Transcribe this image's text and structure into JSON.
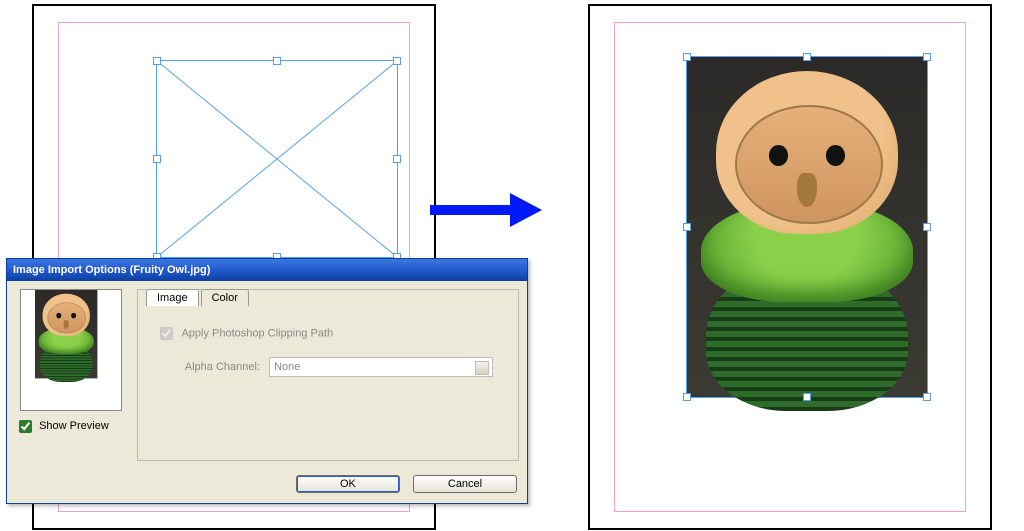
{
  "dialog": {
    "title": "Image Import Options (Fruity Owl.jpg)",
    "tabs": {
      "image": "Image",
      "color": "Color"
    },
    "apply_clipping": "Apply Photoshop Clipping Path",
    "alpha_label": "Alpha Channel:",
    "alpha_value": "None",
    "show_preview": "Show Preview",
    "ok": "OK",
    "cancel": "Cancel"
  }
}
